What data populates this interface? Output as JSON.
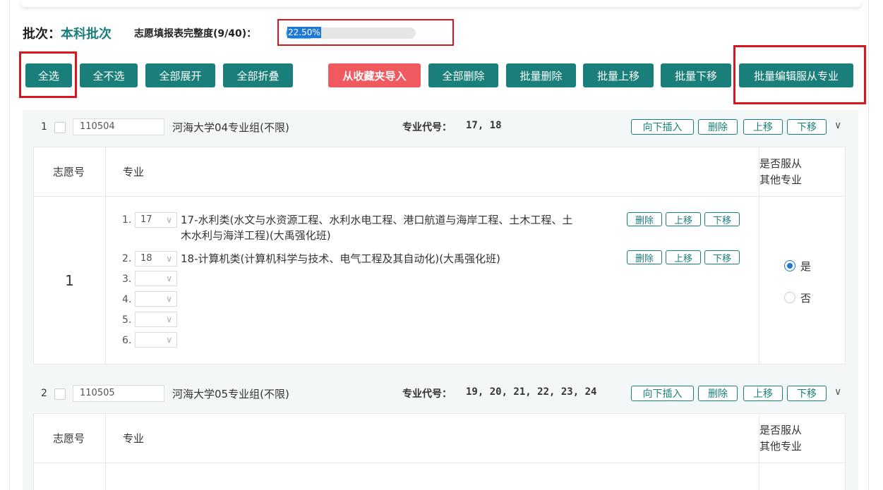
{
  "header": {
    "batch_label": "批次：",
    "batch_value": "本科批次",
    "progress_label": "志愿填报表完整度(9/40)：",
    "progress_text": "22.50%",
    "progress_fraction": 0.225,
    "progress_color": "#5bc6f2"
  },
  "toolbar": {
    "select_all": "全选",
    "select_none": "全不选",
    "expand_all": "全部展开",
    "collapse_all": "全部折叠",
    "import_favorites": "从收藏夹导入",
    "delete_all": "全部删除",
    "batch_delete": "批量删除",
    "batch_up": "批量上移",
    "batch_down": "批量下移",
    "batch_edit_obey": "批量编辑服从专业"
  },
  "colors": {
    "accent": "#1a7f7a",
    "danger": "#f0595e",
    "highlight": "#d9161e"
  },
  "group_actions": {
    "insert_below": "向下插入",
    "delete": "删除",
    "move_up": "上移",
    "move_down": "下移"
  },
  "major_actions": {
    "delete": "删除",
    "move_up": "上移",
    "move_down": "下移"
  },
  "table_headers": {
    "wish_no": "志愿号",
    "major": "专业",
    "obey_line1": "是否服从",
    "obey_line2": "其他专业"
  },
  "codes_label": "专业代号：",
  "groups": [
    {
      "num": "1",
      "code": "110504",
      "name": "河海大学04专业组(不限)",
      "codes": "17, 18",
      "wish_no": "1",
      "majors": [
        {
          "idx": "1.",
          "code": "17",
          "text": "17-水利类(水文与水资源工程、水利水电工程、港口航道与海岸工程、土木工程、土木水利与海洋工程)(大禹强化班)"
        },
        {
          "idx": "2.",
          "code": "18",
          "text": "18-计算机类(计算机科学与技术、电气工程及其自动化)(大禹强化班)"
        },
        {
          "idx": "3.",
          "code": "",
          "text": ""
        },
        {
          "idx": "4.",
          "code": "",
          "text": ""
        },
        {
          "idx": "5.",
          "code": "",
          "text": ""
        },
        {
          "idx": "6.",
          "code": "",
          "text": ""
        }
      ],
      "obey_yes": "是",
      "obey_no": "否"
    },
    {
      "num": "2",
      "code": "110505",
      "name": "河海大学05专业组(不限)",
      "codes": "19, 20, 21, 22, 23, 24"
    }
  ]
}
